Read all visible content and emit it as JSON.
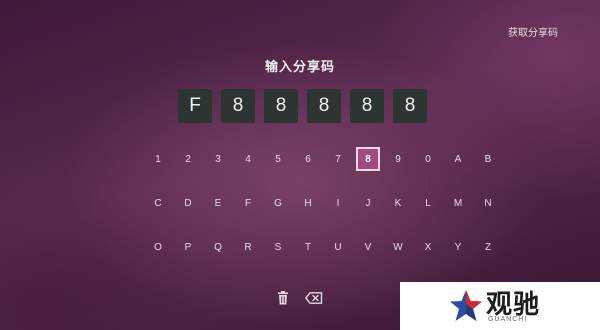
{
  "header": {
    "get_code_link": "获取分享码"
  },
  "title": "输入分享码",
  "code_digits": [
    "F",
    "8",
    "8",
    "8",
    "8",
    "8"
  ],
  "keyboard": {
    "rows": [
      [
        "1",
        "2",
        "3",
        "4",
        "5",
        "6",
        "7",
        "8",
        "9",
        "0",
        "A",
        "B"
      ],
      [
        "C",
        "D",
        "E",
        "F",
        "G",
        "H",
        "I",
        "J",
        "K",
        "L",
        "M",
        "N"
      ],
      [
        "O",
        "P",
        "Q",
        "R",
        "S",
        "T",
        "U",
        "V",
        "W",
        "X",
        "Y",
        "Z"
      ]
    ],
    "selected": "8"
  },
  "actions": {
    "clear_icon": "trash-icon",
    "backspace_icon": "backspace-icon"
  },
  "watermark": {
    "text": "观驰",
    "sub": "GUANCHI"
  },
  "colors": {
    "selected_key": "#a24a82",
    "code_box": "#2c3532"
  }
}
